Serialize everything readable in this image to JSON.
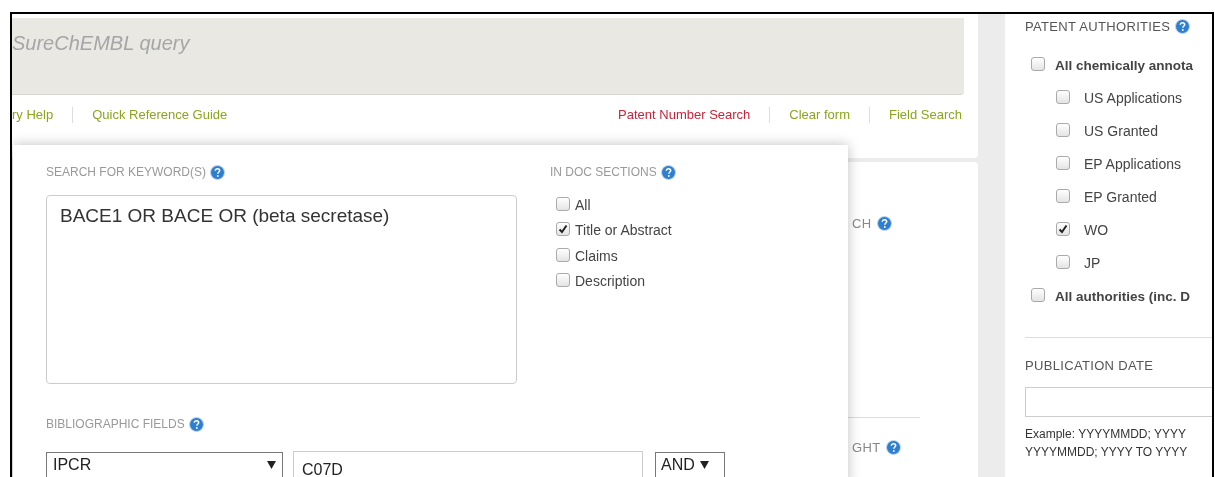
{
  "query_box": {
    "placeholder": "SureChEMBL query"
  },
  "links": [
    {
      "label": "ry Help",
      "selected": false
    },
    {
      "label": "Quick Reference Guide",
      "selected": false
    },
    {
      "label": "Patent Number Search",
      "selected": true
    },
    {
      "label": "Clear form",
      "selected": false
    },
    {
      "label": "Field Search",
      "selected": false
    }
  ],
  "keyword_search": {
    "label": "SEARCH FOR KEYWORD(S)",
    "value": "BACE1 OR BACE OR (beta secretase)"
  },
  "doc_sections": {
    "label": "IN DOC SECTIONS",
    "options": [
      {
        "label": "All",
        "checked": false
      },
      {
        "label": "Title or Abstract",
        "checked": true
      },
      {
        "label": "Claims",
        "checked": false
      },
      {
        "label": "Description",
        "checked": false
      }
    ]
  },
  "bibliographic_fields": {
    "label": "BIBLIOGRAPHIC FIELDS",
    "field": "IPCR",
    "value": "C07D",
    "operator": "AND"
  },
  "background_card": {
    "heading_1": "CH",
    "heading_2": "GHT"
  },
  "patent_authorities": {
    "label": "PATENT AUTHORITIES",
    "groups": [
      {
        "label": "All chemically annota",
        "checked": false,
        "children": [
          {
            "label": "US Applications",
            "checked": false
          },
          {
            "label": "US Granted",
            "checked": false
          },
          {
            "label": "EP Applications",
            "checked": false
          },
          {
            "label": "EP Granted",
            "checked": false
          },
          {
            "label": "WO",
            "checked": true
          },
          {
            "label": "JP",
            "checked": false
          }
        ]
      },
      {
        "label": "All authorities (inc. D",
        "checked": false
      }
    ]
  },
  "publication_date": {
    "label": "PUBLICATION DATE",
    "example_lines": [
      "Example: YYYYMMDD; YYYY",
      "YYYYMMDD; YYYY TO YYYY"
    ]
  }
}
